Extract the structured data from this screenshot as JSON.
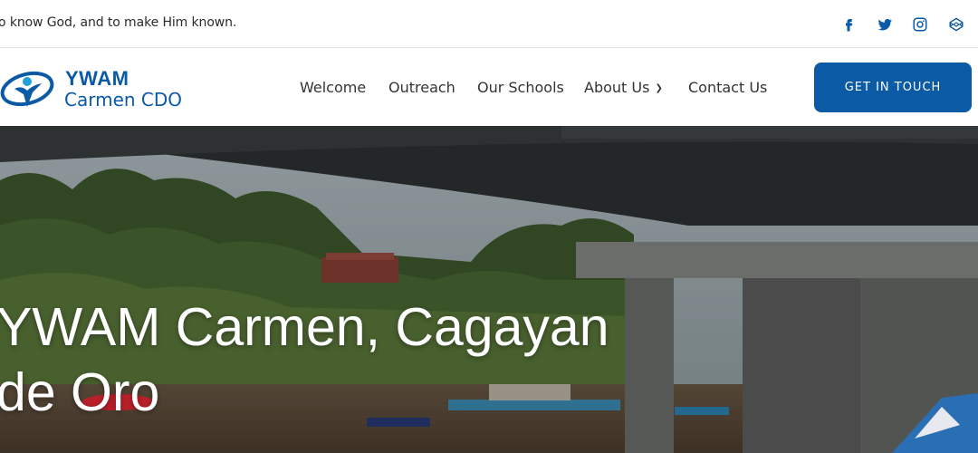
{
  "topbar": {
    "tagline": "o know God, and to make Him known.",
    "social": [
      {
        "icon": "facebook-icon"
      },
      {
        "icon": "twitter-icon"
      },
      {
        "icon": "instagram-icon"
      },
      {
        "icon": "codepen-icon"
      }
    ]
  },
  "header": {
    "logo": {
      "line1": "YWAM",
      "line2": "Carmen CDO"
    },
    "nav": [
      {
        "label": "Welcome"
      },
      {
        "label": "Outreach"
      },
      {
        "label": "Our Schools"
      },
      {
        "label": "About Us",
        "has_dropdown": true
      },
      {
        "label": "Contact Us"
      }
    ],
    "cta_label": "GET IN TOUCH"
  },
  "hero": {
    "title_line1": "YWAM Carmen, Cagayan",
    "title_line2": "de Oro"
  },
  "colors": {
    "brand_blue": "#0b5aa6",
    "text_dark": "#333333"
  }
}
